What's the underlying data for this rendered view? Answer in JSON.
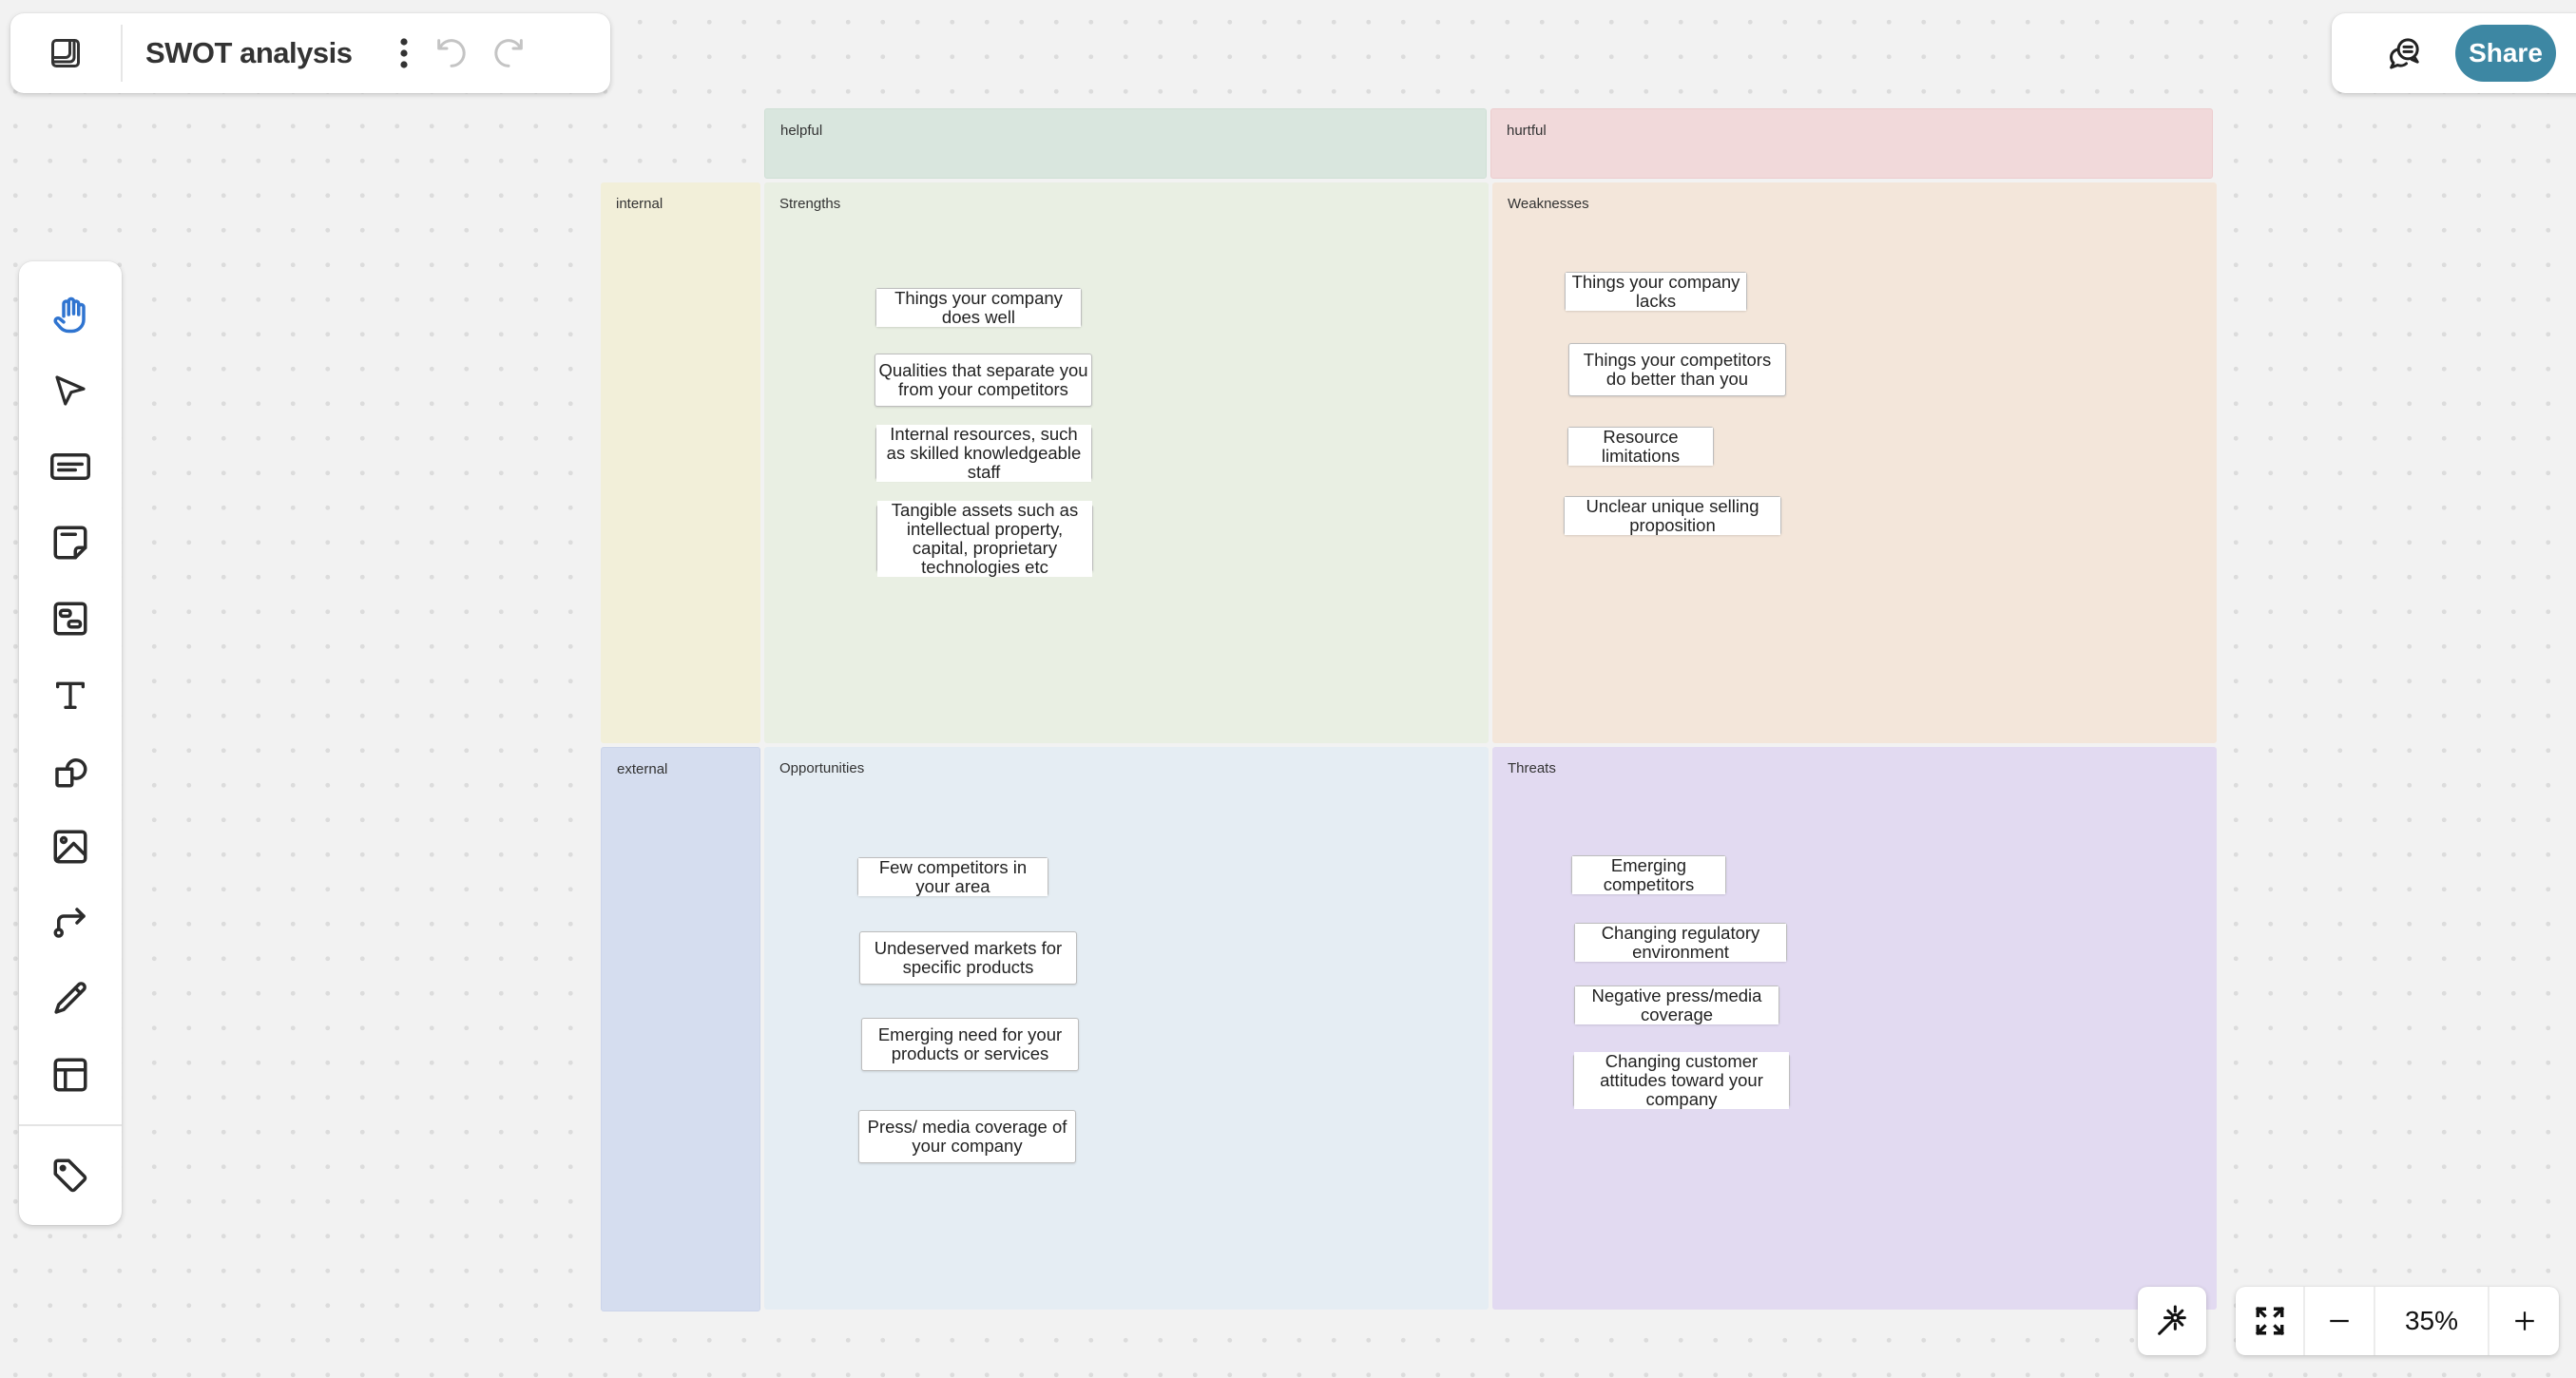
{
  "header": {
    "title": "SWOT analysis",
    "logo_icon": "board-logo-icon",
    "more_icon": "more-vertical-icon",
    "undo_icon": "undo-icon",
    "redo_icon": "redo-icon"
  },
  "topright": {
    "comments_icon": "comments-icon",
    "share_label": "Share",
    "accent_color": "#3d87a3"
  },
  "toolbar": {
    "tools": [
      {
        "name": "hand",
        "icon": "hand-icon",
        "active": true
      },
      {
        "name": "select",
        "icon": "pointer-icon",
        "active": false
      },
      {
        "name": "card",
        "icon": "card-icon",
        "active": false
      },
      {
        "name": "sticky-note",
        "icon": "sticky-note-icon",
        "active": false
      },
      {
        "name": "frame",
        "icon": "frame-icon",
        "active": false
      },
      {
        "name": "text",
        "icon": "text-icon",
        "active": false
      },
      {
        "name": "shapes",
        "icon": "shapes-icon",
        "active": false
      },
      {
        "name": "image",
        "icon": "image-icon",
        "active": false
      },
      {
        "name": "connector",
        "icon": "connector-icon",
        "active": false
      },
      {
        "name": "pen",
        "icon": "pencil-icon",
        "active": false
      },
      {
        "name": "templates",
        "icon": "layout-icon",
        "active": false
      },
      {
        "name": "tags",
        "icon": "tag-icon",
        "active": false
      }
    ],
    "active_color": "#2f74d0"
  },
  "zoom": {
    "value": "35%",
    "fit_icon": "fit-screen-icon",
    "minus_icon": "minus-icon",
    "plus_icon": "plus-icon",
    "magic_icon": "magic-wand-icon"
  },
  "swot": {
    "col_headers": [
      {
        "label": "helpful",
        "color": "#d9e6de"
      },
      {
        "label": "hurtful",
        "color": "#f1d9da"
      }
    ],
    "row_headers": [
      {
        "label": "internal",
        "color": "#f2efd9"
      },
      {
        "label": "external",
        "color": "#d5ddef"
      }
    ],
    "quadrants": [
      {
        "label": "Strengths",
        "color": "#e9efe3",
        "notes": [
          "Things your company does well",
          "Qualities that separate you from your competitors",
          "Internal resources, such as skilled knowledgeable staff",
          "Tangible assets such as intellectual property, capital, proprietary technologies etc"
        ]
      },
      {
        "label": "Weaknesses",
        "color": "#f3e6da",
        "notes": [
          "Things your company lacks",
          "Things your competitors do better than you",
          "Resource limitations",
          "Unclear unique selling proposition"
        ]
      },
      {
        "label": "Opportunities",
        "color": "#e5edf3",
        "notes": [
          "Few competitors in your area",
          "Undeserved markets for specific products",
          "Emerging need for your products or services",
          "Press/ media coverage of your company"
        ]
      },
      {
        "label": "Threats",
        "color": "#e2daf1",
        "notes": [
          "Emerging competitors",
          "Changing regulatory environment",
          "Negative press/media coverage",
          "Changing customer attitudes toward your company"
        ]
      }
    ]
  }
}
